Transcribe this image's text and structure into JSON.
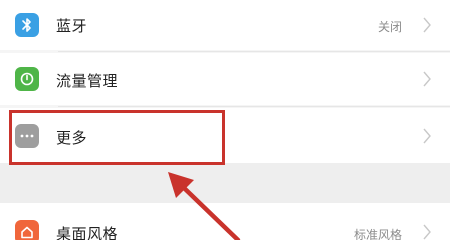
{
  "settings": {
    "items": [
      {
        "label": "蓝牙",
        "value": "关闭",
        "icon": "bluetooth-icon",
        "icon_color": "#3aa0e4"
      },
      {
        "label": "流量管理",
        "value": "",
        "icon": "data-usage-icon",
        "icon_color": "#4fb548"
      },
      {
        "label": "更多",
        "value": "",
        "icon": "more-dots-icon",
        "icon_color": "#9e9e9e"
      },
      {
        "label": "桌面风格",
        "value": "标准风格",
        "icon": "home-icon",
        "icon_color": "#f0663b"
      }
    ]
  },
  "annotation": {
    "color": "#c9332c"
  }
}
